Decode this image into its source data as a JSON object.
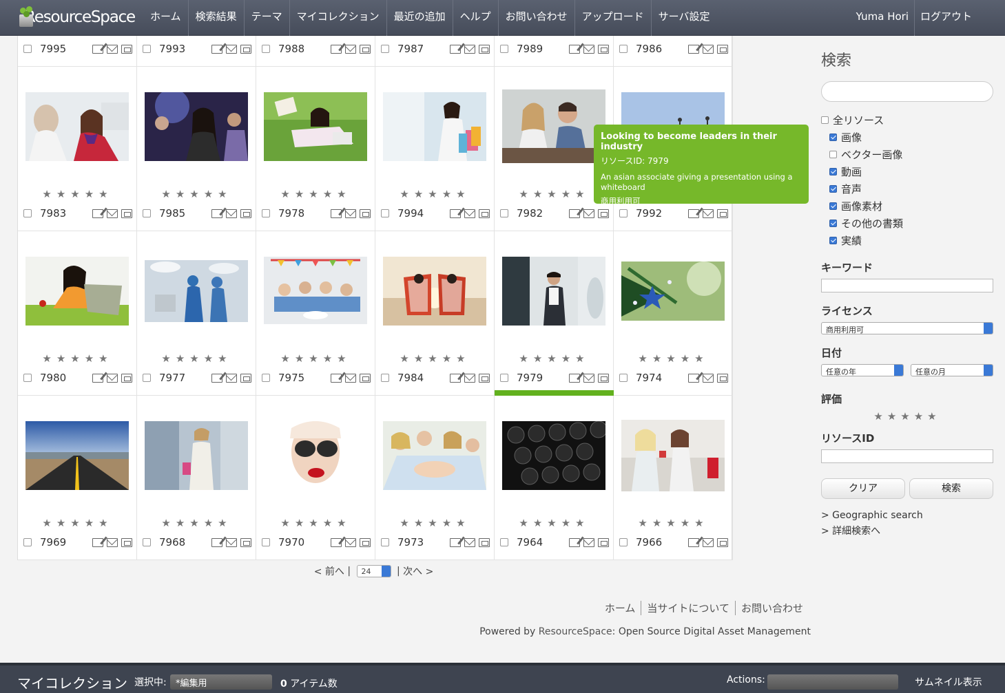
{
  "header": {
    "logo_text": "ResourceSpace",
    "nav": [
      "ホーム",
      "検索結果",
      "テーマ",
      "マイコレクション",
      "最近の追加",
      "ヘルプ",
      "お問い合わせ",
      "アップロード",
      "サーバ設定"
    ],
    "user": "Yuma Hori",
    "logout": "ログアウト"
  },
  "grid": {
    "top_row": [
      "7995",
      "7993",
      "7988",
      "7987",
      "7989",
      "7986"
    ],
    "rows": [
      [
        "7983",
        "7985",
        "7978",
        "7994",
        "7982",
        "7992"
      ],
      [
        "7980",
        "7977",
        "7975",
        "7984",
        "7979",
        "7974"
      ],
      [
        "7969",
        "7968",
        "7970",
        "7973",
        "7964",
        "7966"
      ]
    ],
    "stars": "★★★★★",
    "selected": "7979"
  },
  "tooltip": {
    "title": "Looking to become leaders in their industry",
    "id": "リソースID: 7979",
    "desc": "An asian associate giving a presentation using a whiteboard",
    "license": "商用利用可"
  },
  "pager": {
    "prev": "< 前へ",
    "per_page": "24",
    "next": "次へ >"
  },
  "footer": {
    "links": [
      "ホーム",
      "当サイトについて",
      "お問い合わせ"
    ],
    "powered": "Powered by ",
    "rs": "ResourceSpace",
    "tag": ": Open Source Digital Asset Management"
  },
  "search": {
    "title": "検索",
    "all": "全リソース",
    "types": [
      "画像",
      "ベクター画像",
      "動画",
      "音声",
      "画像素材",
      "その他の書類",
      "実績"
    ],
    "types_checked": [
      true,
      false,
      true,
      true,
      true,
      true,
      true
    ],
    "keyword_label": "キーワード",
    "license_label": "ライセンス",
    "license_value": "商用利用可",
    "date_label": "日付",
    "year": "任意の年",
    "month": "任意の月",
    "rating_label": "評価",
    "rating": "★★★★★",
    "resid_label": "リソースID",
    "clear": "クリア",
    "search": "検索",
    "geo": "> Geographic search",
    "advanced": "> 詳細検索へ"
  },
  "bottom": {
    "title": "マイコレクション",
    "selected_label": "選択中:",
    "collection": "*編集用",
    "count_num": "0",
    "count_label": " アイテム数",
    "actions": "Actions:",
    "thumbs": "サムネイル表示"
  }
}
